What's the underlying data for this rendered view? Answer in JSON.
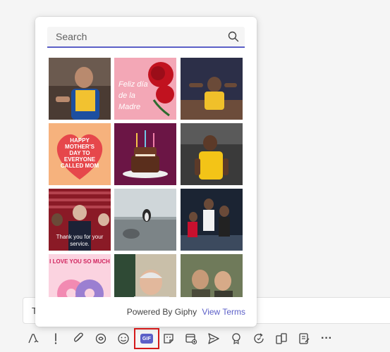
{
  "search": {
    "placeholder": "Search"
  },
  "gifs": [
    {
      "name": "basketball-player-yellow-jersey",
      "caption": ""
    },
    {
      "name": "feliz-dia-de-la-madre-roses",
      "caption": "Feliz día de la Madre"
    },
    {
      "name": "basketball-player-celebrating",
      "caption": ""
    },
    {
      "name": "happy-mothers-day-heart",
      "caption": "HAPPY MOTHER'S DAY TO EVERYONE CALLED MOM"
    },
    {
      "name": "birthday-cake-candles",
      "caption": ""
    },
    {
      "name": "basketball-lakers-player",
      "caption": ""
    },
    {
      "name": "thank-you-for-your-service",
      "caption": "Thank you for your service."
    },
    {
      "name": "penguin-at-window",
      "caption": ""
    },
    {
      "name": "basketball-players-court",
      "caption": ""
    },
    {
      "name": "love-you-so-much-donuts",
      "caption": "I LOVE YOU SO MUCH"
    },
    {
      "name": "man-smiling-kitchen",
      "caption": ""
    },
    {
      "name": "two-men-embrace",
      "caption": ""
    }
  ],
  "footer": {
    "powered_by": "Powered By Giphy",
    "terms_link": "View Terms"
  },
  "compose": {
    "placeholder_visible": "T"
  },
  "toolbar": {
    "gif_label": "GIF",
    "more_label": "···"
  },
  "colors": {
    "accent": "#5b5fc7",
    "highlight": "#d41a1a"
  }
}
